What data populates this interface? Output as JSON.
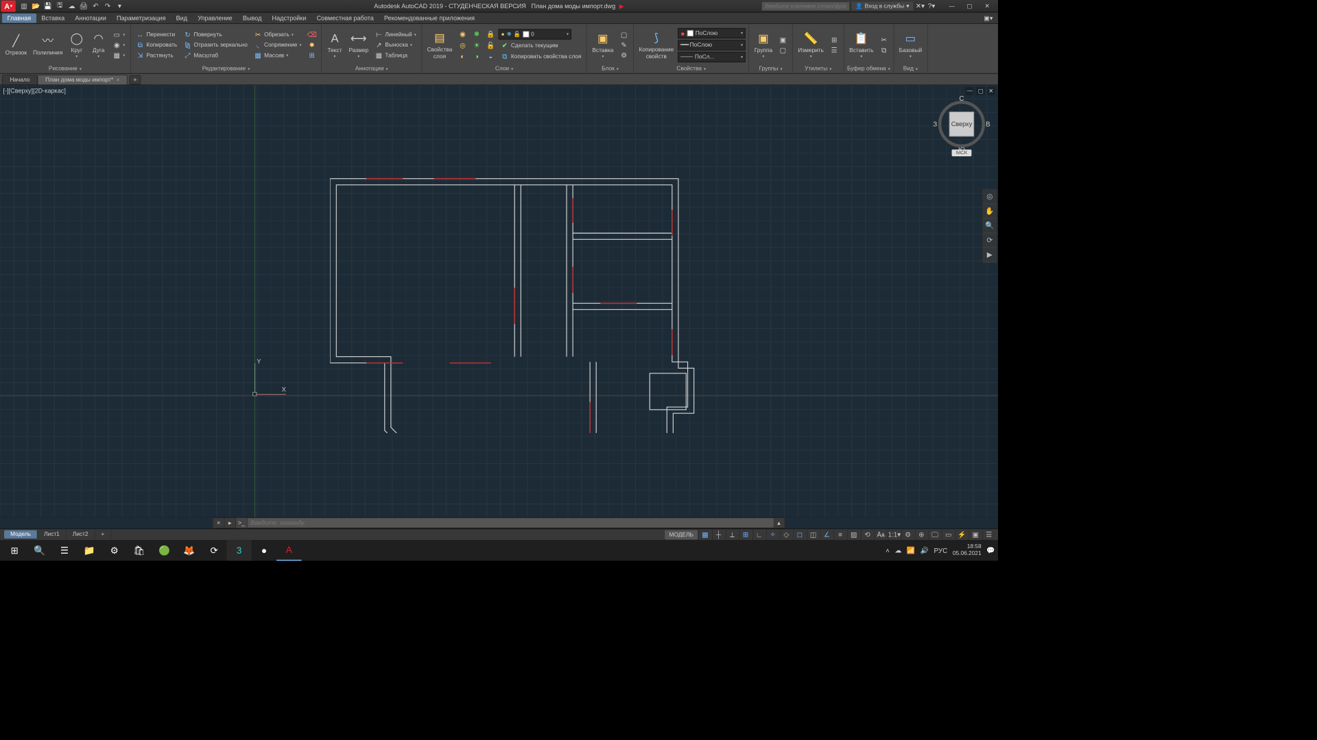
{
  "title_app": "Autodesk AutoCAD 2019 - СТУДЕНЧЕСКАЯ ВЕРСИЯ",
  "title_doc": "План дома моды импорт.dwg",
  "search_placeholder": "Введите ключевое слово/фразу",
  "signin": "Вход в службы",
  "menu": {
    "items": [
      "Главная",
      "Вставка",
      "Аннотации",
      "Параметризация",
      "Вид",
      "Управление",
      "Вывод",
      "Надстройки",
      "Совместная работа",
      "Рекомендованные приложения"
    ]
  },
  "ribbon": {
    "draw": {
      "label": "Рисование",
      "line": "Отрезок",
      "pline": "Полилиния",
      "circle": "Круг",
      "arc": "Дуга"
    },
    "modify": {
      "label": "Редактирование",
      "move": "Перенести",
      "rotate": "Повернуть",
      "trim": "Обрезать",
      "copy": "Копировать",
      "mirror": "Отразить зеркально",
      "fillet": "Сопряжение",
      "stretch": "Растянуть",
      "scale": "Масштаб",
      "array": "Массив"
    },
    "annot": {
      "label": "Аннотации",
      "text": "Текст",
      "dim": "Размер",
      "linear": "Линейный",
      "leader": "Выноска",
      "table": "Таблица"
    },
    "layers": {
      "label": "Слои",
      "props": "Свойства\nслоя",
      "current": "0",
      "makecurrent": "Сделать текущим",
      "copyprops": "Копировать свойства слоя"
    },
    "block": {
      "label": "Блок",
      "insert": "Вставка"
    },
    "props": {
      "label": "Свойства",
      "copy": "Копирование\nсвойств",
      "bylayer": "ПоСлою",
      "bylayer2": "ПоСлою",
      "bylayer3": "ПоСл..."
    },
    "groups": {
      "label": "Группы",
      "group": "Группа"
    },
    "utils": {
      "label": "Утилиты",
      "measure": "Измерить"
    },
    "clip": {
      "label": "Буфер обмена",
      "paste": "Вставить"
    },
    "view": {
      "label": "Вид",
      "base": "Базовый"
    }
  },
  "filetabs": {
    "start": "Начало",
    "doc": "План дома моды импорт*"
  },
  "viewport": "[-][Сверху][2D-каркас]",
  "viewcube": {
    "top": "Сверху",
    "n": "С",
    "s": "Ю",
    "e": "В",
    "w": "З",
    "wcs": "МСК"
  },
  "ucs": {
    "x": "X",
    "y": "Y"
  },
  "cmd": {
    "placeholder": "Введите  команду"
  },
  "layouts": {
    "model": "Модель",
    "l1": "Лист1",
    "l2": "Лист2"
  },
  "status": {
    "model": "МОДЕЛЬ",
    "scale": "1:1"
  },
  "tray": {
    "lang": "РУС",
    "time": "18:58",
    "date": "05.06.2021"
  }
}
